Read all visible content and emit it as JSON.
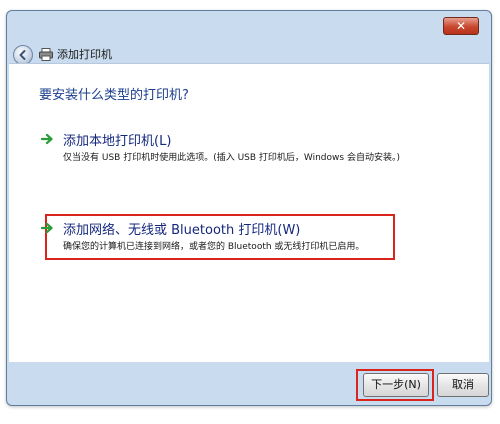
{
  "window": {
    "close_glyph": "✕",
    "title": "添加打印机"
  },
  "content": {
    "question": "要安装什么类型的打印机?",
    "options": [
      {
        "label": "添加本地打印机(L)",
        "description": "仅当没有 USB 打印机时使用此选项。(插入 USB 打印机后，Windows 会自动安装。)"
      },
      {
        "label": "添加网络、无线或 Bluetooth 打印机(W)",
        "description": "确保您的计算机已连接到网络，或者您的 Bluetooth 或无线打印机已启用。"
      }
    ]
  },
  "footer": {
    "next_label": "下一步(N)",
    "cancel_label": "取消"
  },
  "colors": {
    "highlight": "#d9251c",
    "arrow": "#2a9d3a",
    "link_text": "#14287e"
  },
  "icons": [
    "close-icon",
    "back-arrow-icon",
    "printer-icon",
    "green-arrow-icon"
  ]
}
